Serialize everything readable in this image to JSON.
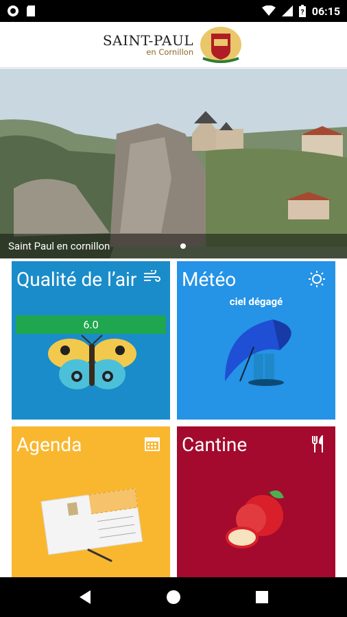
{
  "status_bar": {
    "time": "06:15"
  },
  "header": {
    "logo_main": "SAINT-PAUL",
    "logo_sub": "en Cornillon"
  },
  "hero": {
    "caption": "Saint Paul en cornillon"
  },
  "tiles": {
    "air": {
      "title": "Qualité de l’air",
      "value": "6.0"
    },
    "meteo": {
      "title": "Météo",
      "description": "ciel dégagé"
    },
    "agenda": {
      "title": "Agenda"
    },
    "cantine": {
      "title": "Cantine"
    }
  },
  "icons": {
    "air": "wind-icon",
    "meteo": "sun-icon",
    "agenda": "calendar-icon",
    "cantine": "fork-knife-icon"
  },
  "colors": {
    "air": "#1a8cc9",
    "meteo": "#2593e6",
    "agenda": "#f9b72f",
    "cantine": "#a40a2e",
    "aqi_bar": "#1fa64e"
  }
}
